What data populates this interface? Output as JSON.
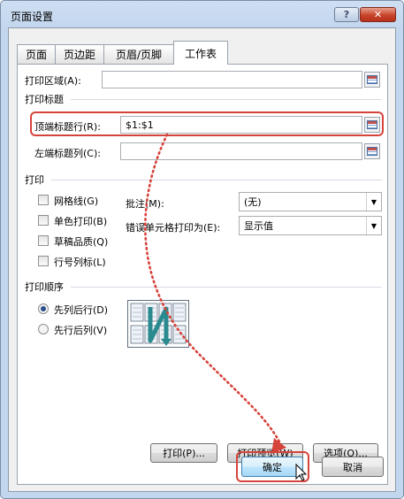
{
  "window": {
    "title": "页面设置",
    "help_glyph": "?",
    "close_glyph": "✕"
  },
  "tabs": [
    {
      "label": "页面",
      "active": false
    },
    {
      "label": "页边距",
      "active": false
    },
    {
      "label": "页眉/页脚",
      "active": false
    },
    {
      "label": "工作表",
      "active": true
    }
  ],
  "print_area": {
    "label": "打印区域(A):",
    "value": ""
  },
  "print_titles": {
    "section": "打印标题",
    "rows_label": "顶端标题行(R):",
    "rows_value": "$1:$1",
    "cols_label": "左端标题列(C):",
    "cols_value": ""
  },
  "print": {
    "section": "打印",
    "gridlines": {
      "label": "网格线(G)",
      "checked": false
    },
    "mono": {
      "label": "单色打印(B)",
      "checked": false
    },
    "draft": {
      "label": "草稿品质(Q)",
      "checked": false
    },
    "headings": {
      "label": "行号列标(L)",
      "checked": false
    },
    "comments_label": "批注(M):",
    "comments_value": "(无)",
    "errors_label": "错误单元格打印为(E):",
    "errors_value": "显示值"
  },
  "page_order": {
    "section": "打印顺序",
    "down_then_over": {
      "label": "先列后行(D)",
      "selected": true
    },
    "over_then_down": {
      "label": "先行后列(V)",
      "selected": false
    }
  },
  "buttons": {
    "print": "打印(P)...",
    "preview": "打印预览(W)",
    "options": "选项(O)...",
    "ok": "确定",
    "cancel": "取消"
  },
  "colors": {
    "highlight": "#d6433b",
    "titlebar": "#c2d6ee",
    "arrow_teal": "#2a8a8f"
  }
}
